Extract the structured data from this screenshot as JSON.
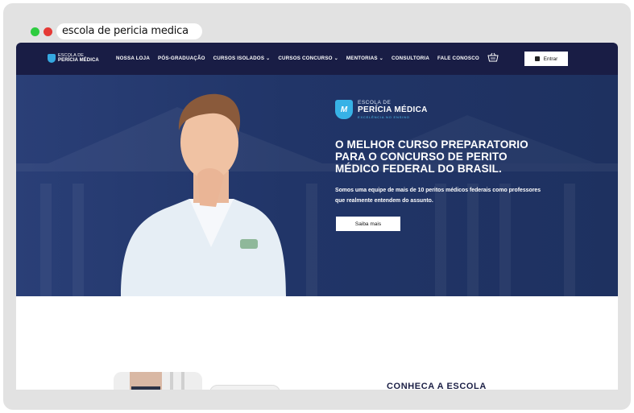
{
  "browser": {
    "address_text": "escola de pericia medica",
    "dot_colors": [
      "#2ecc40",
      "#e53935"
    ]
  },
  "nav": {
    "logo_line1": "ESCOLA DE",
    "logo_line2": "PERÍCIA MÉDICA",
    "items": [
      {
        "label": "NOSSA LOJA",
        "has_dropdown": false
      },
      {
        "label": "PÓS-GRADUAÇÃO",
        "has_dropdown": false
      },
      {
        "label": "CURSOS ISOLADOS",
        "has_dropdown": true
      },
      {
        "label": "CURSOS CONCURSO",
        "has_dropdown": true
      },
      {
        "label": "MENTORIAS",
        "has_dropdown": true
      },
      {
        "label": "CONSULTORIA",
        "has_dropdown": false
      },
      {
        "label": "FALE CONOSCO",
        "has_dropdown": false
      }
    ],
    "cart_icon": "shopping-basket-icon",
    "login_label": "Entrar",
    "background": "#191d45"
  },
  "hero": {
    "logo_top": "ESCOLA DE",
    "logo_main": "PERÍCIA MÉDICA",
    "logo_tagline": "EXCELÊNCIA NO ENSINO",
    "logo_mark": "M",
    "headline": "O MELHOR CURSO PREPARATORIO PARA O CONCURSO DE PERITO MÉDICO FEDERAL DO BRASIL.",
    "subtext": "Somos uma equipe de mais de 10 peritos médicos federais como professores que realmente entendem do assunto.",
    "cta_label": "Saiba mais",
    "background": "#23376b",
    "accent": "#37b2e6"
  },
  "section": {
    "title": "CONHECA A ESCOLA"
  }
}
